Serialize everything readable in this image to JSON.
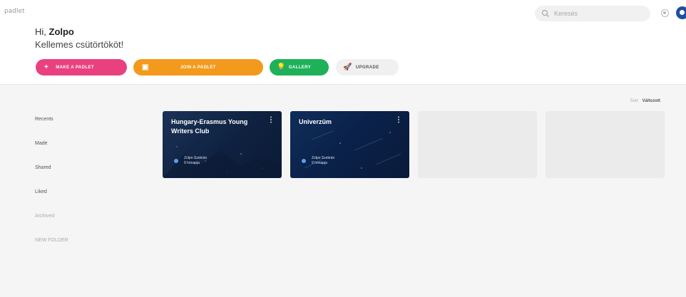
{
  "app": {
    "logo": "padlet"
  },
  "search": {
    "placeholder": "Keresés"
  },
  "greeting": {
    "prefix": "Hi, ",
    "name": "Zolpo",
    "subtitle": "Kellemes csütörtököt!"
  },
  "actions": [
    {
      "label": "MAKE A PADLET",
      "icon": "plus-icon",
      "color": "#e9417f"
    },
    {
      "label": "JOIN A PADLET",
      "icon": "qr-code-icon",
      "color": "#f39a1c"
    },
    {
      "label": "GALLERY",
      "icon": "lightbulb-icon",
      "color": "#1fb05a"
    },
    {
      "label": "UPGRADE",
      "icon": "rocket-icon",
      "color": "#f0f0f0"
    }
  ],
  "sort": {
    "label": "Sort",
    "value": "Változott"
  },
  "sidebar": {
    "items": [
      {
        "label": "Recents"
      },
      {
        "label": "Made"
      },
      {
        "label": "Shared"
      },
      {
        "label": "Liked"
      },
      {
        "label": "Archived"
      },
      {
        "label": "NEW FOLDER"
      }
    ]
  },
  "padlets": [
    {
      "title": "Hungary-Erasmus Young Writers Club",
      "owner": "Zolpo Szekrán",
      "time": "9 hónapja",
      "background": "#102444"
    },
    {
      "title": "Univerzüm",
      "owner": "Zolpo Szekrán",
      "time": "9 hónapja",
      "background": "#0a2148"
    }
  ]
}
